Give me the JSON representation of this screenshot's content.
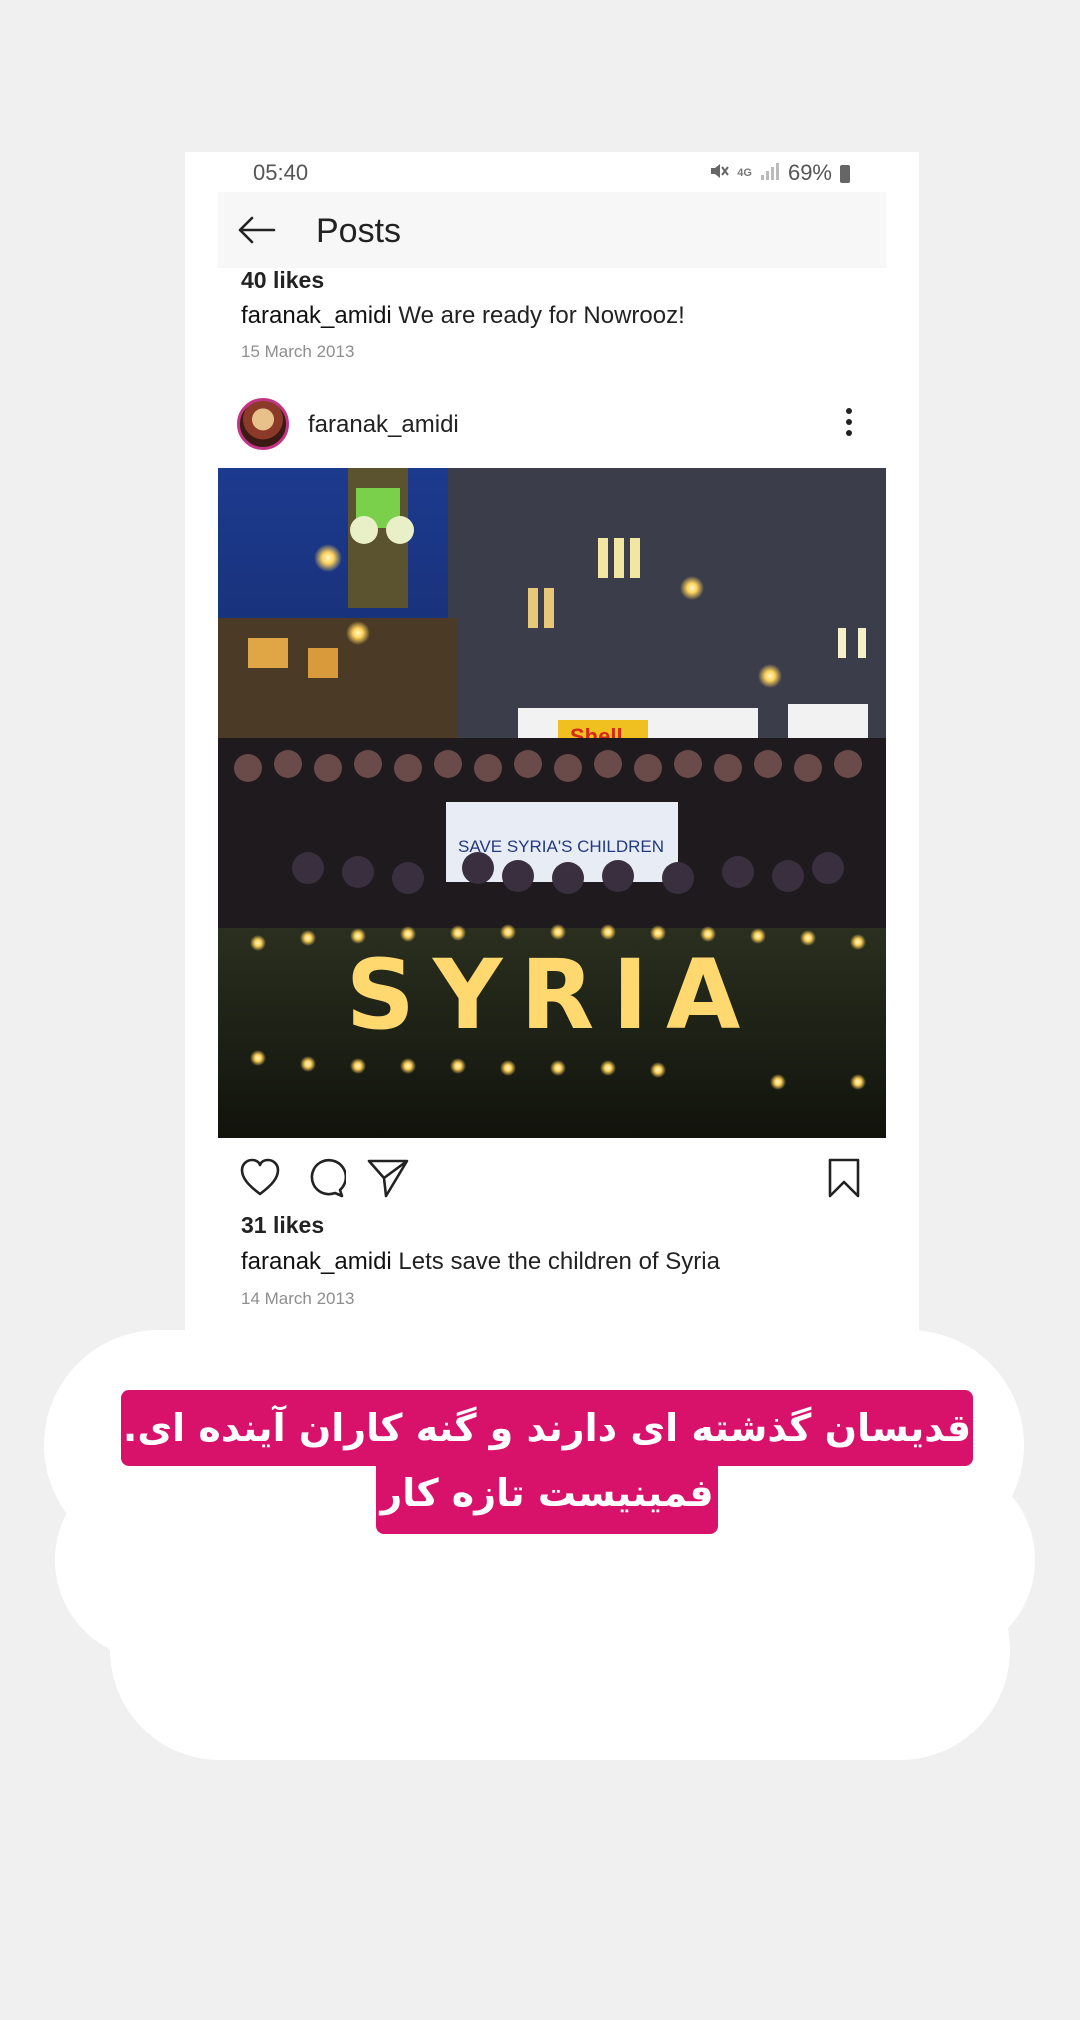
{
  "status_bar": {
    "time": "05:40",
    "network": "4G",
    "battery": "69%",
    "icons": [
      "mute-icon",
      "network-4g-icon",
      "signal-icon",
      "battery-icon"
    ]
  },
  "app_bar": {
    "title": "Posts",
    "back_icon": "arrow-left-icon"
  },
  "previous_post": {
    "likes": "40 likes",
    "username": "faranak_amidi",
    "caption": "We are ready for Nowrooz!",
    "date": "15 March 2013"
  },
  "post": {
    "username": "faranak_amidi",
    "more_icon": "more-vertical-icon",
    "image_description": "Candlelight vigil at night in front of Westminster, candles spelling SYRIA",
    "image_text": {
      "banner": "SAVE SYRIA'S CHILDREN",
      "candles": "SYRIA",
      "truck": "Shell"
    },
    "actions": [
      "heart-icon",
      "comment-icon",
      "share-icon",
      "bookmark-icon"
    ],
    "likes": "31 likes",
    "caption": "Lets save the children of Syria",
    "date": "14 March 2013"
  },
  "overlay": {
    "line1": "قدیسان گذشته ای دارند و گنه کاران آینده ای.",
    "line2": "فمینیست تازه کار",
    "color": "#d8116b"
  }
}
